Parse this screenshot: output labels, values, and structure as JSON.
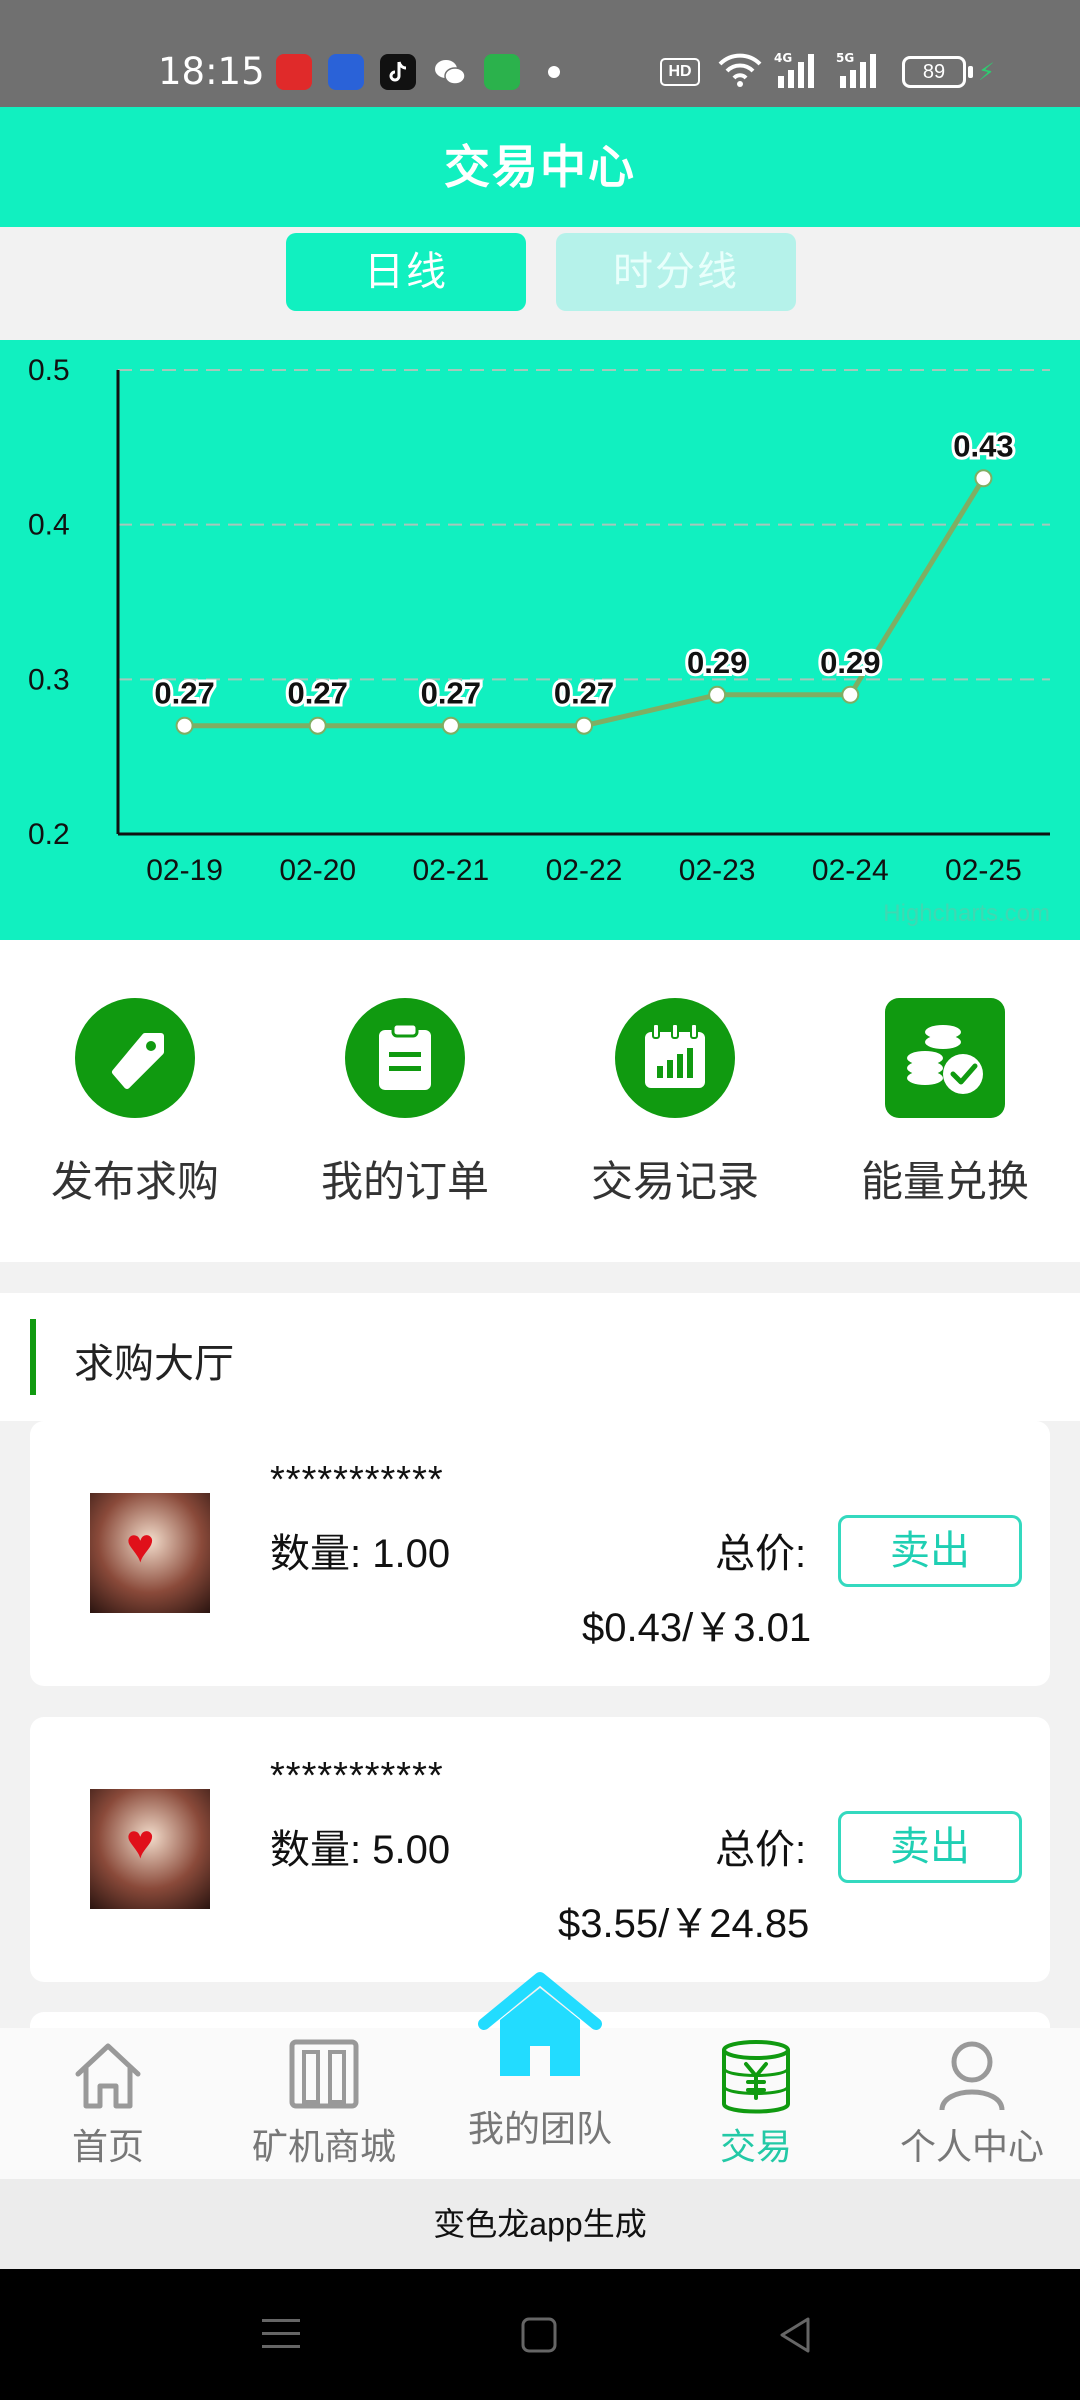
{
  "status_bar": {
    "time": "18:15",
    "hd_label": "HD",
    "signal_labels": [
      "4G",
      "5G"
    ],
    "battery": "89"
  },
  "header": {
    "title": "交易中心"
  },
  "tabs": [
    {
      "label": "日线",
      "active": true
    },
    {
      "label": "时分线",
      "active": false
    }
  ],
  "chart_data": {
    "type": "line",
    "categories": [
      "02-19",
      "02-20",
      "02-21",
      "02-22",
      "02-23",
      "02-24",
      "02-25"
    ],
    "values": [
      0.27,
      0.27,
      0.27,
      0.27,
      0.29,
      0.29,
      0.43
    ],
    "data_labels": [
      "0.27",
      "0.27",
      "0.27",
      "0.27",
      "0.29",
      "0.29",
      "0.43"
    ],
    "yticks": [
      "0.2",
      "0.3",
      "0.4",
      "0.5"
    ],
    "ylim": [
      0.2,
      0.5
    ],
    "grid": "dashed horizontal",
    "line_color": "#7fae63",
    "background": "#11f0c0",
    "credit": "Highcharts.com"
  },
  "quick_menu": [
    {
      "label": "发布求购",
      "icon": "tag-icon"
    },
    {
      "label": "我的订单",
      "icon": "clipboard-icon"
    },
    {
      "label": "交易记录",
      "icon": "calendar-chart-icon"
    },
    {
      "label": "能量兑换",
      "icon": "coins-check-icon"
    }
  ],
  "section": {
    "title": "求购大厅"
  },
  "orders": [
    {
      "name": "***********",
      "qty_label": "数量:",
      "qty": "1.00",
      "total_label": "总价:",
      "price": "$0.43/￥3.01",
      "action": "卖出"
    },
    {
      "name": "***********",
      "qty_label": "数量:",
      "qty": "5.00",
      "total_label": "总价:",
      "price": "$3.55/￥24.85",
      "action": "卖出"
    }
  ],
  "bottom_nav": [
    {
      "label": "首页",
      "icon": "home-outline-icon",
      "active": false
    },
    {
      "label": "矿机商城",
      "icon": "store-icon",
      "active": false
    },
    {
      "label": "我的团队",
      "icon": "home-filled-icon",
      "active": false
    },
    {
      "label": "交易",
      "icon": "yuan-database-icon",
      "active": true
    },
    {
      "label": "个人中心",
      "icon": "person-icon",
      "active": false
    }
  ],
  "footer": {
    "text": "变色龙app生成"
  },
  "colors": {
    "accent": "#11f0c0",
    "green": "#109a10",
    "button_border": "#34d9bf",
    "active_nav": "#23c9a6"
  }
}
